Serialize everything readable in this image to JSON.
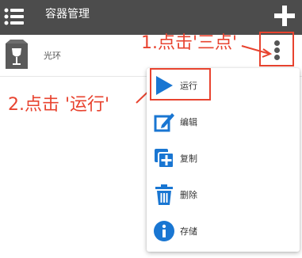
{
  "header": {
    "title": "容器管理",
    "menu_icon": "hamburger-menu-icon",
    "add_icon": "plus-icon",
    "background": "#4c4c4c"
  },
  "container_row": {
    "icon": "wine-glass-box-icon",
    "label": "光环",
    "more_icon": "three-dots-vertical-icon"
  },
  "annotations": {
    "step1": "1.点击'三点'",
    "step2": "2.点击 '运行'",
    "color": "#e8432f"
  },
  "menu": {
    "items": [
      {
        "label": "运行",
        "icon": "play-icon",
        "highlighted": true
      },
      {
        "label": "编辑",
        "icon": "edit-icon"
      },
      {
        "label": "复制",
        "icon": "copy-icon"
      },
      {
        "label": "删除",
        "icon": "trash-icon"
      },
      {
        "label": "存储",
        "icon": "info-icon"
      }
    ]
  },
  "colors": {
    "accent_blue": "#1976d2",
    "annotation_red": "#e8432f"
  }
}
